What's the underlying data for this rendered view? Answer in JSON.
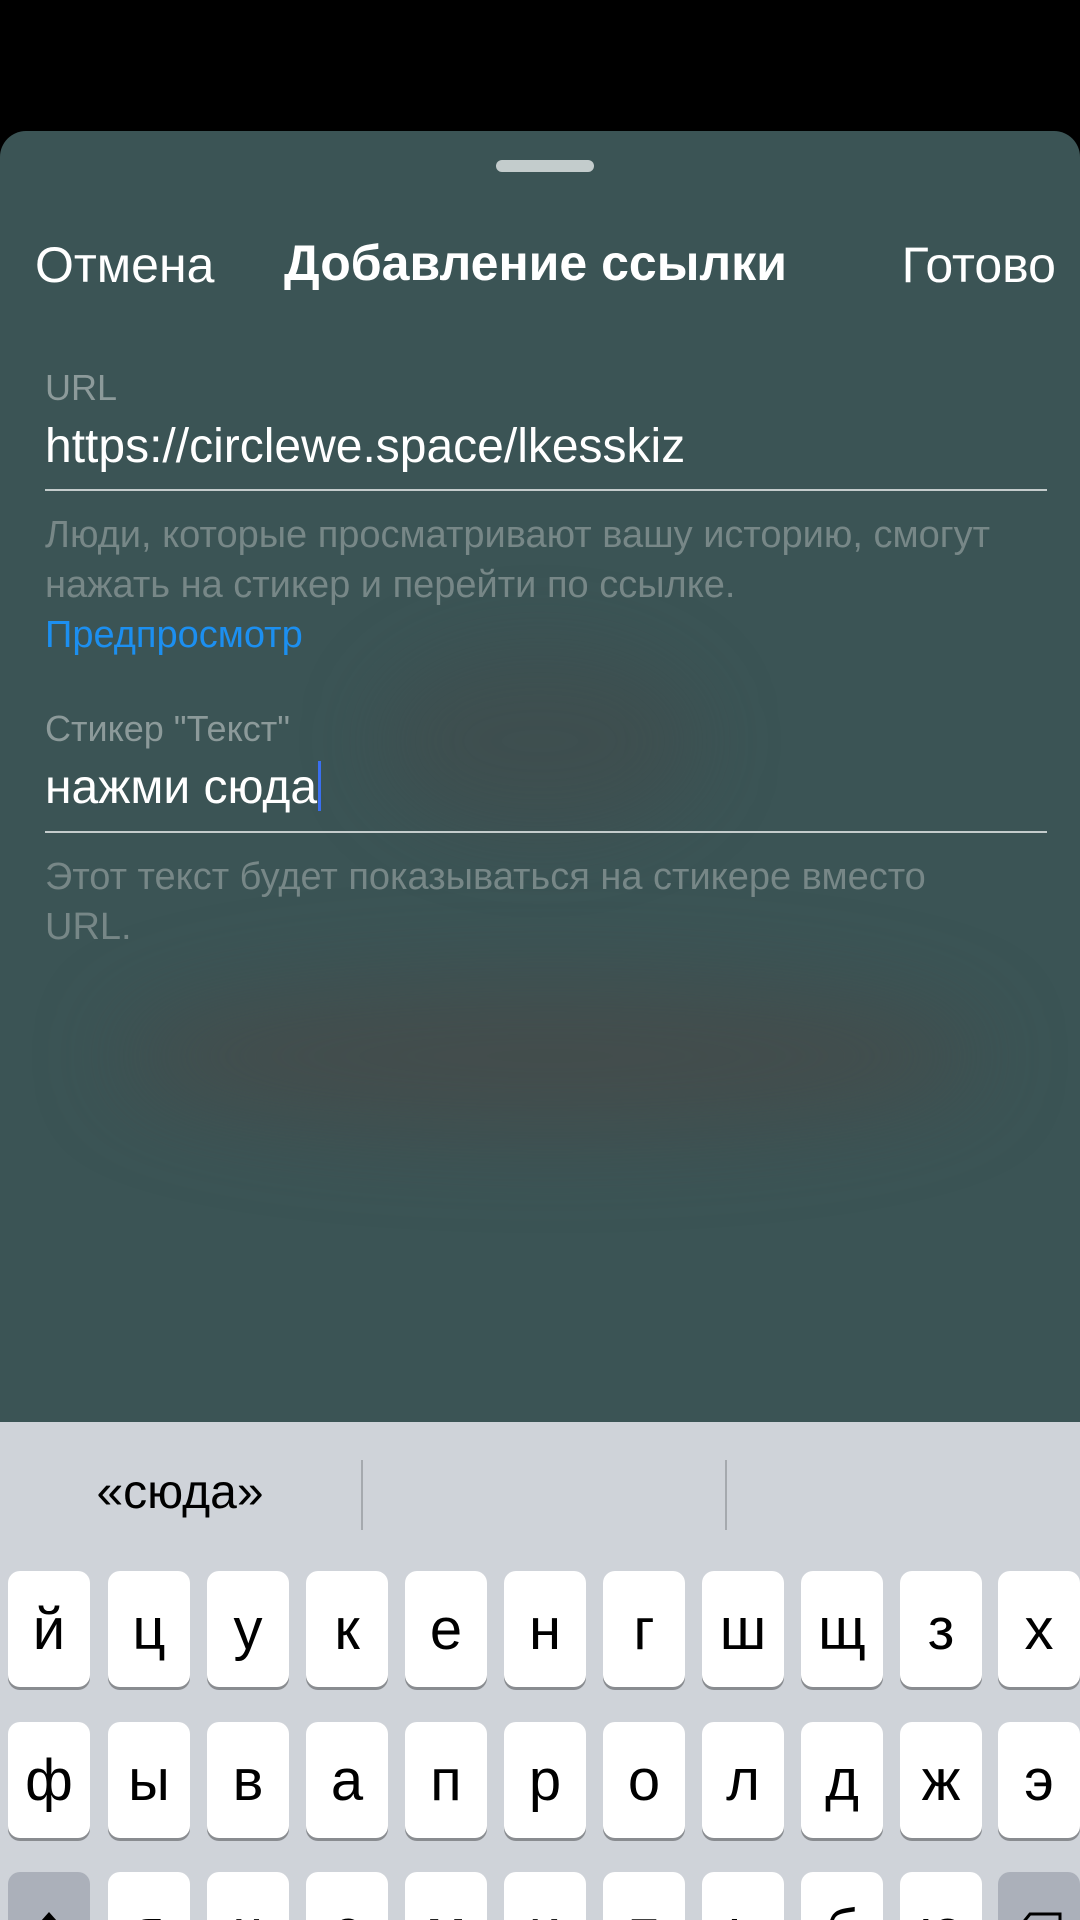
{
  "nav": {
    "cancel": "Отмена",
    "title": "Добавление ссылки",
    "done": "Готово"
  },
  "url_field": {
    "label": "URL",
    "value": "https://circlewe.space/lkesskiz"
  },
  "url_hint": {
    "text": "Люди, которые просматривают вашу историю, смогут нажать на стикер и перейти по ссылке.",
    "preview_link": "Предпросмотр"
  },
  "sticker_field": {
    "label": "Стикер \"Текст\"",
    "value": "нажми сюда"
  },
  "sticker_hint": {
    "text": "Этот текст будет показываться на стикере вместо URL."
  },
  "keyboard": {
    "suggestions": [
      "«сюда»",
      "",
      ""
    ],
    "row1": [
      "й",
      "ц",
      "у",
      "к",
      "е",
      "н",
      "г",
      "ш",
      "щ",
      "з",
      "х"
    ],
    "row2": [
      "ф",
      "ы",
      "в",
      "а",
      "п",
      "р",
      "о",
      "л",
      "д",
      "ж",
      "э"
    ],
    "row3": [
      "я",
      "ч",
      "с",
      "м",
      "и",
      "т",
      "ь",
      "б",
      "ю"
    ],
    "shift_icon": "shift-arrow-icon",
    "backspace_icon": "backspace-icon"
  },
  "colors": {
    "sheet_background": "#3b5455",
    "link": "#1c8ff0",
    "keyboard_background": "#cfd3d9"
  }
}
